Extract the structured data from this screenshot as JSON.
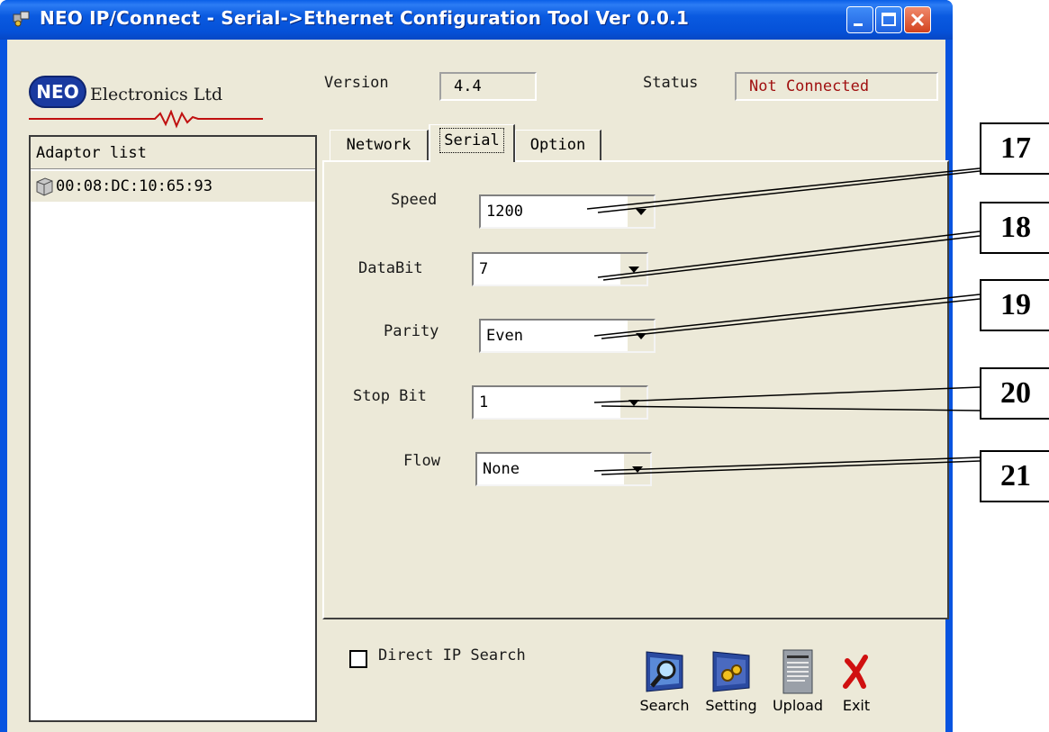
{
  "window": {
    "title": "NEO IP/Connect - Serial->Ethernet Configuration Tool Ver 0.0.1",
    "controls": [
      "minimize",
      "maximize",
      "close"
    ]
  },
  "logo": {
    "badge": "NEO",
    "company": "Electronics Ltd"
  },
  "header": {
    "version_label": "Version",
    "version_value": "4.4",
    "status_label": "Status",
    "status_value": "Not Connected",
    "status_color": "#a01010"
  },
  "adaptor_list": {
    "header": "Adaptor list",
    "items": [
      {
        "mac": "00:08:DC:10:65:93",
        "icon": "adaptor-device-icon"
      }
    ]
  },
  "tabs": {
    "items": [
      "Network",
      "Serial",
      "Option"
    ],
    "active": "Serial"
  },
  "serial": {
    "fields": [
      {
        "label": "Speed",
        "value": "1200"
      },
      {
        "label": "DataBit",
        "value": "7"
      },
      {
        "label": "Parity",
        "value": "Even"
      },
      {
        "label": "Stop Bit",
        "value": "1"
      },
      {
        "label": "Flow",
        "value": "None"
      }
    ]
  },
  "bottom": {
    "direct_ip_search_label": "Direct IP Search",
    "direct_ip_search_checked": false,
    "tools": [
      {
        "label": "Search",
        "icon": "search-monitor-icon"
      },
      {
        "label": "Setting",
        "icon": "setting-monitor-icon"
      },
      {
        "label": "Upload",
        "icon": "upload-document-icon"
      },
      {
        "label": "Exit",
        "icon": "exit-x-icon"
      }
    ]
  },
  "callouts": [
    "17",
    "18",
    "19",
    "20",
    "21"
  ]
}
